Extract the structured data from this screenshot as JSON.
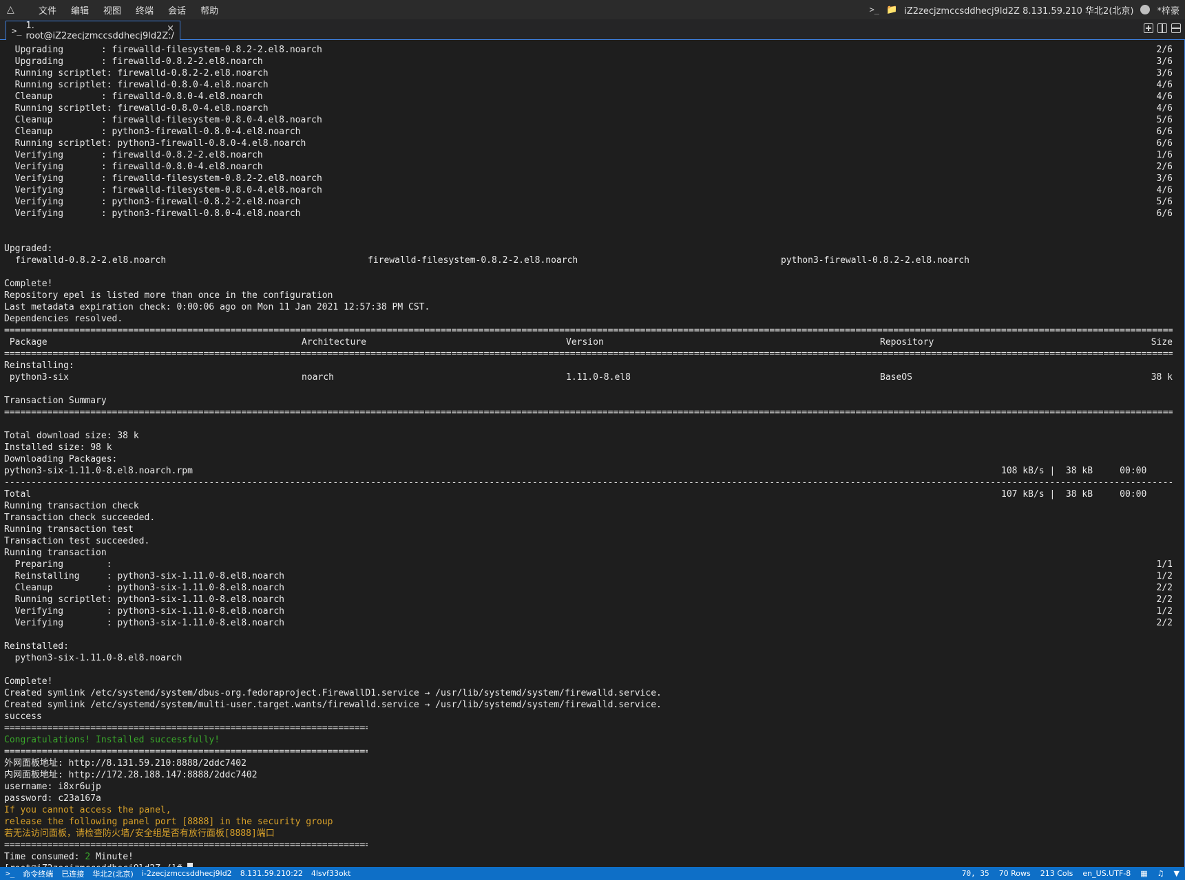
{
  "menubar": {
    "items": [
      "文件",
      "编辑",
      "视图",
      "终端",
      "会话",
      "帮助"
    ],
    "host": "iZ2zecjzmccsddhecj9ld2Z 8.131.59.210 华北2(北京)",
    "user": "*梓豪"
  },
  "tab": {
    "label": "1. root@iZ2zecjzmccsddhecj9ld2Z:/",
    "close": "×"
  },
  "terminal": {
    "scriptlet_lines": [
      {
        "action": "  Upgrading       ",
        "pkg": "firewalld-filesystem-0.8.2-2.el8.noarch",
        "count": "2/6"
      },
      {
        "action": "  Upgrading       ",
        "pkg": "firewalld-0.8.2-2.el8.noarch",
        "count": "3/6"
      },
      {
        "action": "  Running scriptlet",
        "pkg": "firewalld-0.8.2-2.el8.noarch",
        "count": "3/6"
      },
      {
        "action": "  Running scriptlet",
        "pkg": "firewalld-0.8.0-4.el8.noarch",
        "count": "4/6"
      },
      {
        "action": "  Cleanup         ",
        "pkg": "firewalld-0.8.0-4.el8.noarch",
        "count": "4/6"
      },
      {
        "action": "  Running scriptlet",
        "pkg": "firewalld-0.8.0-4.el8.noarch",
        "count": "4/6"
      },
      {
        "action": "  Cleanup         ",
        "pkg": "firewalld-filesystem-0.8.0-4.el8.noarch",
        "count": "5/6"
      },
      {
        "action": "  Cleanup         ",
        "pkg": "python3-firewall-0.8.0-4.el8.noarch",
        "count": "6/6"
      },
      {
        "action": "  Running scriptlet",
        "pkg": "python3-firewall-0.8.0-4.el8.noarch",
        "count": "6/6"
      },
      {
        "action": "  Verifying       ",
        "pkg": "firewalld-0.8.2-2.el8.noarch",
        "count": "1/6"
      },
      {
        "action": "  Verifying       ",
        "pkg": "firewalld-0.8.0-4.el8.noarch",
        "count": "2/6"
      },
      {
        "action": "  Verifying       ",
        "pkg": "firewalld-filesystem-0.8.2-2.el8.noarch",
        "count": "3/6"
      },
      {
        "action": "  Verifying       ",
        "pkg": "firewalld-filesystem-0.8.0-4.el8.noarch",
        "count": "4/6"
      },
      {
        "action": "  Verifying       ",
        "pkg": "python3-firewall-0.8.2-2.el8.noarch",
        "count": "5/6"
      },
      {
        "action": "  Verifying       ",
        "pkg": "python3-firewall-0.8.0-4.el8.noarch",
        "count": "6/6"
      }
    ],
    "upgraded_header": "Upgraded:",
    "upgraded": [
      "firewalld-0.8.2-2.el8.noarch",
      "firewalld-filesystem-0.8.2-2.el8.noarch",
      "python3-firewall-0.8.2-2.el8.noarch"
    ],
    "complete": "Complete!",
    "repo_warning": "Repository epel is listed more than once in the configuration",
    "metadata_check": "Last metadata expiration check: 0:00:06 ago on Mon 11 Jan 2021 12:57:38 PM CST.",
    "deps_resolved": "Dependencies resolved.",
    "table_headers": {
      "package": " Package",
      "arch": "Architecture",
      "version": "Version",
      "repo": "Repository",
      "size": "Size"
    },
    "reinstalling_header": "Reinstalling:",
    "reinstall_row": {
      "package": " python3-six",
      "arch": "noarch",
      "version": "1.11.0-8.el8",
      "repo": "BaseOS",
      "size": "38 k"
    },
    "transaction_summary": "Transaction Summary",
    "total_download": "Total download size: 38 k",
    "installed_size": "Installed size: 98 k",
    "downloading_packages": "Downloading Packages:",
    "download_file": "python3-six-1.11.0-8.el8.noarch.rpm",
    "download_stats": "108 kB/s |  38 kB     00:00",
    "total_label": "Total",
    "total_stats": "107 kB/s |  38 kB     00:00",
    "txn_lines": [
      "Running transaction check",
      "Transaction check succeeded.",
      "Running transaction test",
      "Transaction test succeeded.",
      "Running transaction"
    ],
    "txn_steps": [
      {
        "action": "  Preparing        :",
        "pkg": "",
        "count": "1/1"
      },
      {
        "action": "  Reinstalling     :",
        "pkg": " python3-six-1.11.0-8.el8.noarch",
        "count": "1/2"
      },
      {
        "action": "  Cleanup          :",
        "pkg": " python3-six-1.11.0-8.el8.noarch",
        "count": "2/2"
      },
      {
        "action": "  Running scriptlet:",
        "pkg": " python3-six-1.11.0-8.el8.noarch",
        "count": "2/2"
      },
      {
        "action": "  Verifying        :",
        "pkg": " python3-six-1.11.0-8.el8.noarch",
        "count": "1/2"
      },
      {
        "action": "  Verifying        :",
        "pkg": " python3-six-1.11.0-8.el8.noarch",
        "count": "2/2"
      }
    ],
    "reinstalled_header": "Reinstalled:",
    "reinstalled_pkg": "  python3-six-1.11.0-8.el8.noarch",
    "complete2": "Complete!",
    "symlink1": "Created symlink /etc/systemd/system/dbus-org.fedoraproject.FirewallD1.service → /usr/lib/systemd/system/firewalld.service.",
    "symlink2": "Created symlink /etc/systemd/system/multi-user.target.wants/firewalld.service → /usr/lib/systemd/system/firewalld.service.",
    "success": "success",
    "congrats": "Congratulations! Installed successfully!",
    "external_panel": "外网面板地址: http://8.131.59.210:8888/2ddc7402",
    "internal_panel": "内网面板地址: http://172.28.188.147:8888/2ddc7402",
    "username": "username: i8xr6ujp",
    "password": "password: c23a167a",
    "warn1": "If you cannot access the panel,",
    "warn2": "release the following panel port [8888] in the security group",
    "warn3": "若无法访问面板，请检查防火墙/安全组是否有放行面板[8888]端口",
    "time_prefix": "Time consumed: ",
    "time_value": "2",
    "time_suffix": " Minute!",
    "prompt": "[root@iZ2zecjzmccsddhecj9ld2Z /]# "
  },
  "statusbar": {
    "terminal_label": "命令终端",
    "connected": "已连接",
    "region": "华北2(北京)",
    "instance": "i-2zecjzmccsddhecj9ld2",
    "address": "8.131.59.210:22",
    "session": "4lsvf33okt",
    "cursor_pos": "70, 35",
    "rows": "70 Rows",
    "cols": "213 Cols",
    "encoding": "en_US.UTF-8"
  },
  "colors": {
    "accent": "#0e6fc7",
    "green": "#3aa82b",
    "orange": "#d8a12a"
  }
}
